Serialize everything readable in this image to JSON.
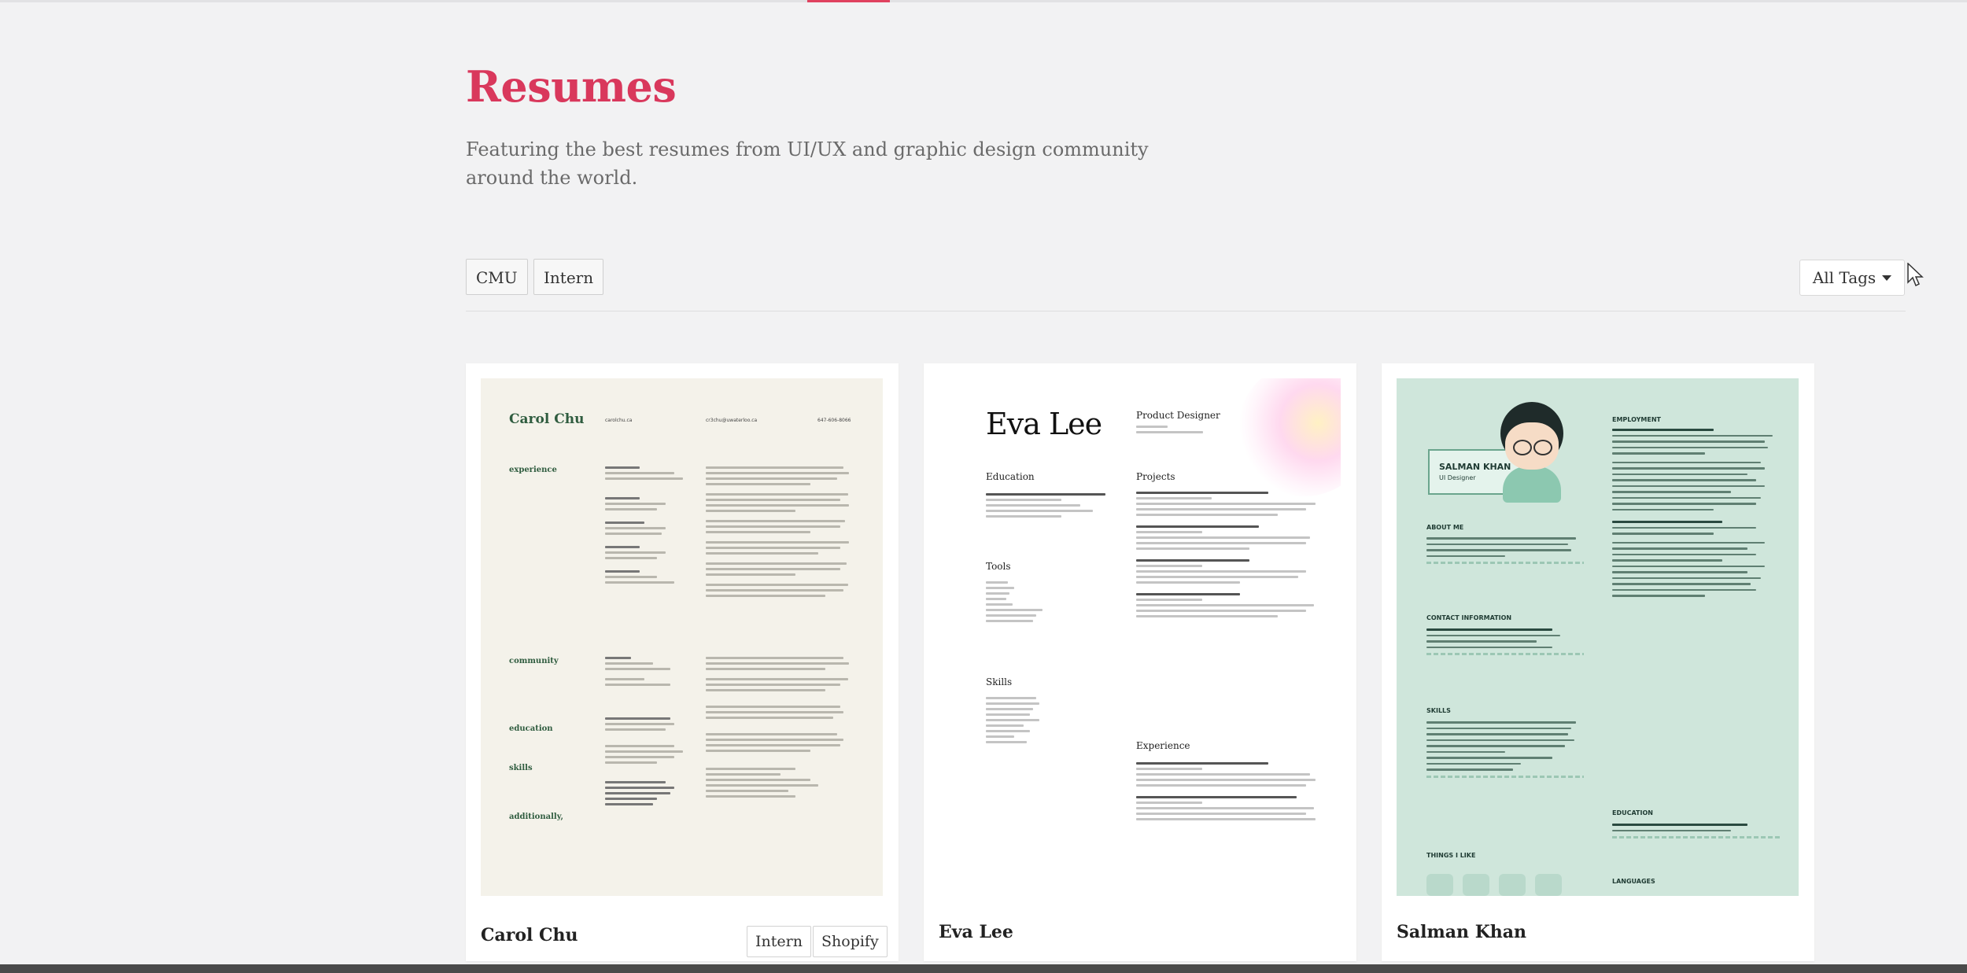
{
  "page": {
    "title": "Resumes",
    "subtitle": "Featuring the best resumes from UI/UX and graphic design community around the world."
  },
  "filters": {
    "tags": [
      "CMU",
      "Intern"
    ],
    "all_tags_label": "All Tags"
  },
  "cards": [
    {
      "name": "Carol Chu",
      "tags": [
        "Intern",
        "Shopify"
      ],
      "preview": {
        "name": "Carol Chu",
        "sections": [
          "experience",
          "community",
          "education",
          "skills",
          "additionally,"
        ],
        "contacts": [
          "carolchu.ca",
          "cr3chu@uwaterloo.ca",
          "647-606-8066"
        ]
      }
    },
    {
      "name": "Eva Lee",
      "tags": [],
      "preview": {
        "name": "Eva Lee",
        "role": "Product Designer",
        "sections": [
          "Education",
          "Projects",
          "Tools",
          "Skills",
          "Experience"
        ]
      }
    },
    {
      "name": "Salman Khan",
      "tags": [],
      "preview": {
        "name": "SALMAN KHAN",
        "role": "UI Designer",
        "sections": [
          "EMPLOYMENT",
          "ABOUT ME",
          "CONTACT INFORMATION",
          "SKILLS",
          "EDUCATION",
          "THINGS I LIKE",
          "LANGUAGES"
        ]
      }
    }
  ],
  "colors": {
    "accent": "#d9385c",
    "background": "#f2f2f3",
    "card": "#ffffff",
    "carol_preview_bg": "#f4f2ea",
    "salman_preview_bg": "#cfe6db"
  },
  "icons": {
    "dropdown": "caret-down-icon",
    "cursor": "mouse-pointer-icon"
  }
}
